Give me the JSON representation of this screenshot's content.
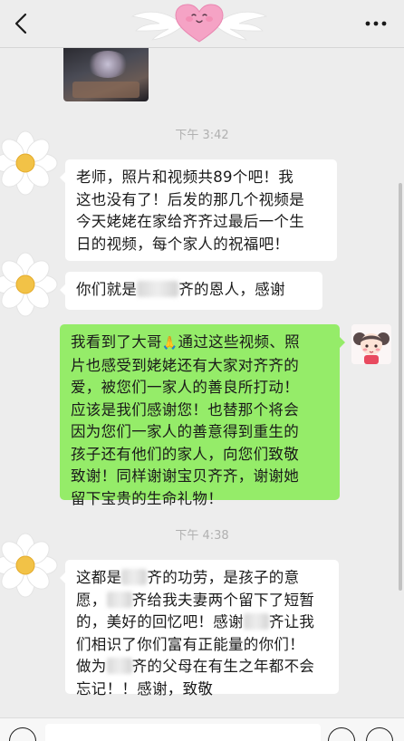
{
  "header": {
    "back_icon": "chevron-left-icon",
    "title_icon": "winged-heart-icon",
    "more_icon": "more-dots-icon",
    "more_label": "···"
  },
  "messages": [
    {
      "type": "image",
      "side": "right"
    },
    {
      "type": "time",
      "text": "下午 3:42"
    },
    {
      "type": "text",
      "side": "left",
      "text": "老师，照片和视频共89个吧！我\n这也没有了！后发的那几个视频是\n今天姥姥在家给齐齐过最后一个生\n日的视频，每个家人的祝福吧！"
    },
    {
      "type": "text",
      "side": "left",
      "parts": [
        "你们就是",
        "齐的恩人，感谢"
      ]
    },
    {
      "type": "text",
      "side": "right",
      "parts": [
        "我看到了大哥",
        "🙏",
        "通过这些视频、照\n片也感受到姥姥还有大家对齐齐的\n爱，被您们一家人的善良所打动！\n应该是我们感谢您！也替那个将会\n因为您们一家人的善意得到重生的\n孩子还有他们的家人，向您们致敬\n致谢！同样谢谢宝贝齐齐，谢谢她\n留下宝贵的生命礼物！"
      ]
    },
    {
      "type": "time",
      "text": "下午 4:38"
    },
    {
      "type": "text",
      "side": "left",
      "parts": [
        "这都是",
        "齐的功劳，是孩子的意\n愿，",
        "齐给我夫妻两个留下了短暂\n的，美好的回忆吧！感谢",
        "齐让我\n们相识了你们富有正能量的你们！\n做为",
        "齐的父母在有生之年都不会\n忘记！！感谢，致敬"
      ]
    }
  ],
  "avatars": {
    "left": "daisy-flower-icon",
    "right": "cartoon-girl-icon"
  },
  "input_bar": {
    "voice_icon": "voice-icon",
    "emoji_icon": "emoji-icon",
    "plus_icon": "plus-icon",
    "input_value": ""
  },
  "colors": {
    "background": "#ededed",
    "self_bubble": "#95ec69",
    "other_bubble": "#ffffff",
    "timestamp": "#b0b0b0"
  }
}
